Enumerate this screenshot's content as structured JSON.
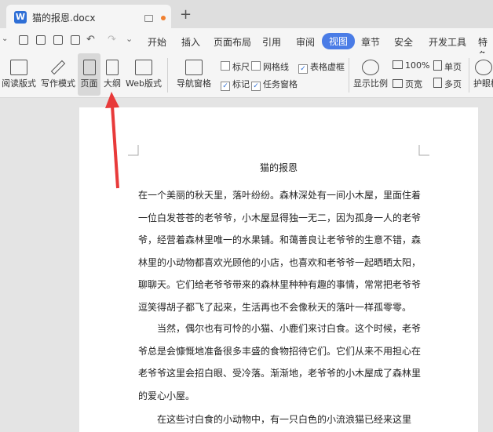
{
  "tab": {
    "filename": "猫的报恩.docx",
    "icon_letter": "W"
  },
  "menu": [
    "开始",
    "插入",
    "页面布局",
    "引用",
    "审阅",
    "视图",
    "章节",
    "安全",
    "开发工具",
    "特色"
  ],
  "ribbon": {
    "read_mode": "阅读版式",
    "write_mode": "写作模式",
    "page_view": "页面",
    "outline": "大纲",
    "web_view": "Web版式",
    "nav_pane": "导航窗格",
    "ruler": "标尺",
    "gridlines": "网格线",
    "table_gridlines": "表格虚框",
    "bookmark": "标记",
    "task_pane": "任务窗格",
    "zoom_ratio": "显示比例",
    "zoom_100": "100%",
    "page_width": "页宽",
    "single_page": "单页",
    "multi_page": "多页",
    "eye_mode": "护眼模"
  },
  "document": {
    "title": "猫的报恩",
    "paragraphs": [
      [
        "在一个美丽的秋天里，落叶纷纷。森林深处有一间小木屋，里面住着",
        "一位白发苍苍的老爷爷，小木屋显得独一无二，因为孤身一人的老爷",
        "爷，经营着森林里唯一的水果铺。和蔼善良让老爷爷的生意不错，森",
        "林里的小动物都喜欢光顾他的小店，也喜欢和老爷爷一起晒晒太阳，",
        "聊聊天。它们给老爷爷带来的森林里种种有趣的事情，常常把老爷爷",
        "逗笑得胡子都飞了起来，生活再也不会像秋天的落叶一样孤零零。"
      ],
      [
        "　　当然，偶尔也有可怜的小猫、小鹿们来讨白食。这个时候，老爷",
        "爷总是会慷慨地准备很多丰盛的食物招待它们。它们从来不用担心在",
        "老爷爷这里会招白眼、受冷落。渐渐地，老爷爷的小木屋成了森林里",
        "的爱心小屋。"
      ],
      [
        "　　在这些讨白食的小动物中，有一只白色的小流浪猫已经来这里"
      ]
    ]
  },
  "colors": {
    "accent": "#4a7ce6",
    "arrow": "#e83a3a",
    "word_blue": "#2f6fd6"
  }
}
